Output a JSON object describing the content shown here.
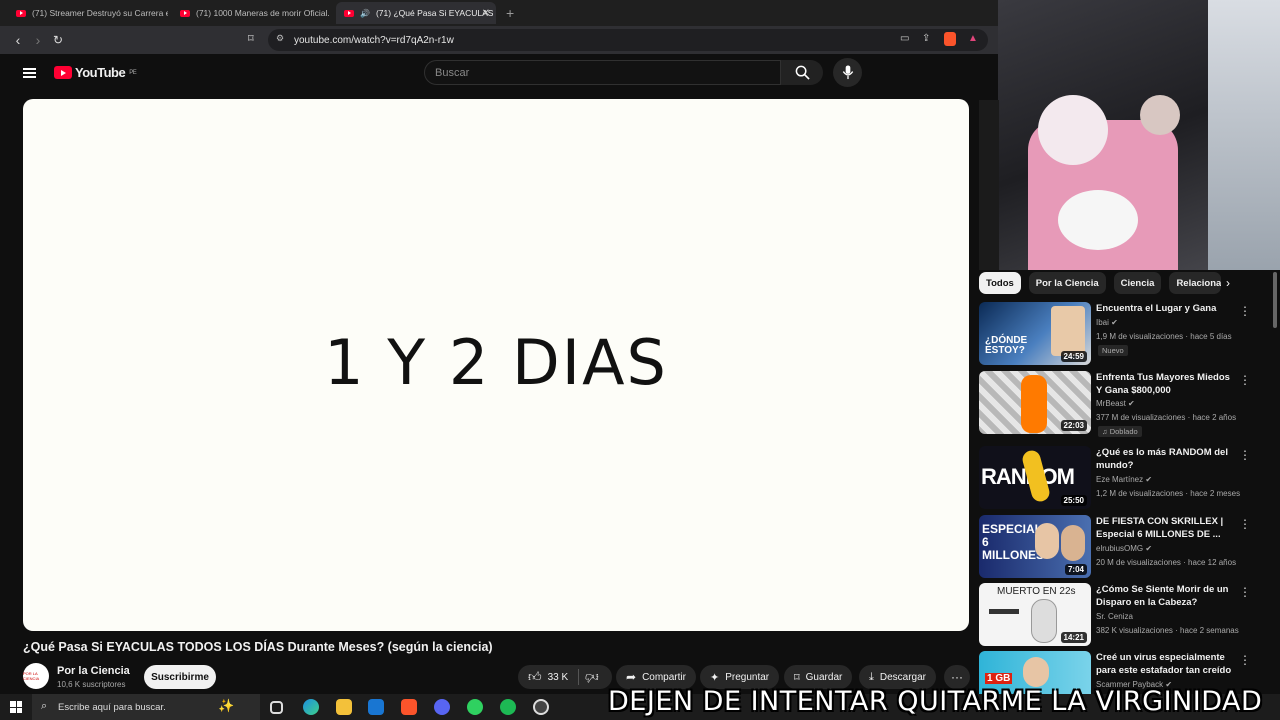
{
  "browser": {
    "tabs": [
      {
        "label": "(71) Streamer Destruyó su Carrera en"
      },
      {
        "label": "(71) 1000 Maneras de morir Oficial. -"
      },
      {
        "label": "(71) ¿Qué Pasa Si EYACULAS"
      }
    ],
    "url": "youtube.com/watch?v=rd7qA2n-r1w"
  },
  "header": {
    "logo": "YouTube",
    "region": "PE",
    "search_placeholder": "Buscar"
  },
  "video": {
    "frame_text": "1 Y 2 DIAS",
    "title": "¿Qué Pasa Si EYACULAS TODOS LOS DÍAS Durante Meses? (según la ciencia)",
    "channel": "Por la Ciencia",
    "avatar_text": "POR LA CIENCIA",
    "subscribers": "10,6 K suscriptores",
    "subscribe": "Suscribirme",
    "likes": "33 K",
    "share": "Compartir",
    "ask": "Preguntar",
    "save": "Guardar",
    "download": "Descargar"
  },
  "sidebar": {
    "chips": [
      "Todos",
      "Por la Ciencia",
      "Ciencia",
      "Relacionad"
    ],
    "items": [
      {
        "title": "Encuentra el Lugar y Gana",
        "channel": "Ibai",
        "meta": "1,9 M de visualizaciones · hace 5 días",
        "badge": "Nuevo",
        "duration": "24:59",
        "thumb_text": "¿DÓNDE ESTOY?"
      },
      {
        "title": "Enfrenta Tus Mayores Miedos Y Gana $800,000",
        "channel": "MrBeast",
        "meta": "377 M de visualizaciones · hace 2 años",
        "badge": "Doblado",
        "duration": "22:03",
        "thumb_text": ""
      },
      {
        "title": "¿Qué es lo más RANDOM del mundo?",
        "channel": "Eze Martínez",
        "meta": "1,2 M de visualizaciones · hace 2 meses",
        "badge": "",
        "duration": "25:50",
        "thumb_text": "RANDOM"
      },
      {
        "title": "DE FIESTA CON SKRILLEX | Especial 6 MILLONES DE ...",
        "channel": "elrubiusOMG",
        "meta": "20 M de visualizaciones · hace 12 años",
        "badge": "",
        "duration": "7:04",
        "thumb_text": "ESPECIAL 6 MILLONES"
      },
      {
        "title": "¿Cómo Se Siente Morir de un Disparo en la Cabeza?",
        "channel": "Sr. Ceniza",
        "meta": "382 K visualizaciones · hace 2 semanas",
        "badge": "",
        "duration": "14:21",
        "thumb_text": "MUERTO EN 22s"
      },
      {
        "title": "Creé un virus especialmente para este estafador tan creído",
        "channel": "Scammer Payback",
        "meta": "",
        "badge": "",
        "duration": "",
        "thumb_text": "1 GB"
      }
    ]
  },
  "taskbar": {
    "search": "Escribe aquí para buscar."
  },
  "overlay": {
    "caption": "DEJEN DE INTENTAR QUITARME LA VIRGINIDAD"
  }
}
